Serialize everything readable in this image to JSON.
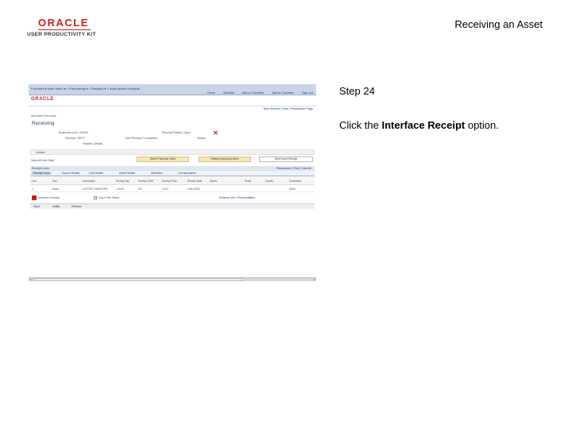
{
  "header": {
    "logo_brand": "ORACLE",
    "logo_sub": "USER PRODUCTIVITY KIT",
    "doc_title": "Receiving an Asset"
  },
  "step": {
    "number": "Step 24",
    "instr_prefix": "Click the ",
    "instr_target": "Interface Receipt",
    "instr_suffix": " option."
  },
  "screenshot": {
    "menu_crumb": "Favorites ▾   Main Menu ▾   > Purchasing ▾   > Receipts ▾   > Add/Update Receipts",
    "menu_nav": [
      "Home",
      "Worklist",
      "Add to Favorites",
      "Add to Favorites",
      "Sign out"
    ],
    "brand": "ORACLE",
    "new_window": "New Window | Help | Personalize Page",
    "unit_caption": "Maintain Receipts",
    "page_title": "Receiving",
    "fields": {
      "business_unit": "Business Unit: US001",
      "receipt": "Receipt: NEXT",
      "receipt_status": "Receipt Status: Open",
      "add_comments": "Add Receipt Comments",
      "status_text": "Status",
      "header_details": "Header Details"
    },
    "header_bar": "Header",
    "buttons": [
      "Select Purchase Order",
      "Retrieve Approved Items",
      "Run/Cancel Receipt"
    ],
    "view_all": "View All Line Data",
    "grid_title": "Receipt Lines",
    "grid_links": "Personalize | Find | View All",
    "tabs": [
      "Receipt Lines",
      "Source Details",
      "Line Details",
      "Asset Details",
      "Attributes",
      "Lot Information"
    ],
    "columns": [
      "Line",
      "Item",
      "Description",
      "Receipt Qty",
      "Receipt UOM",
      "Receipt Price",
      "Receipt Date",
      "Status",
      "Serial",
      "Copies",
      "Scheduled"
    ],
    "row": [
      "1",
      "Asset",
      "LAPTOP COMPUTER",
      "1.0000",
      "EA",
      "15.00",
      "10/01/2024",
      "Open"
    ],
    "interface_option": "Interface Receipt",
    "checkbox_label": "Save Pick Sheet",
    "receive_info": "Receive Info / Reconciliation",
    "toolbar": [
      "Save",
      "Notify",
      "Refresh"
    ]
  }
}
